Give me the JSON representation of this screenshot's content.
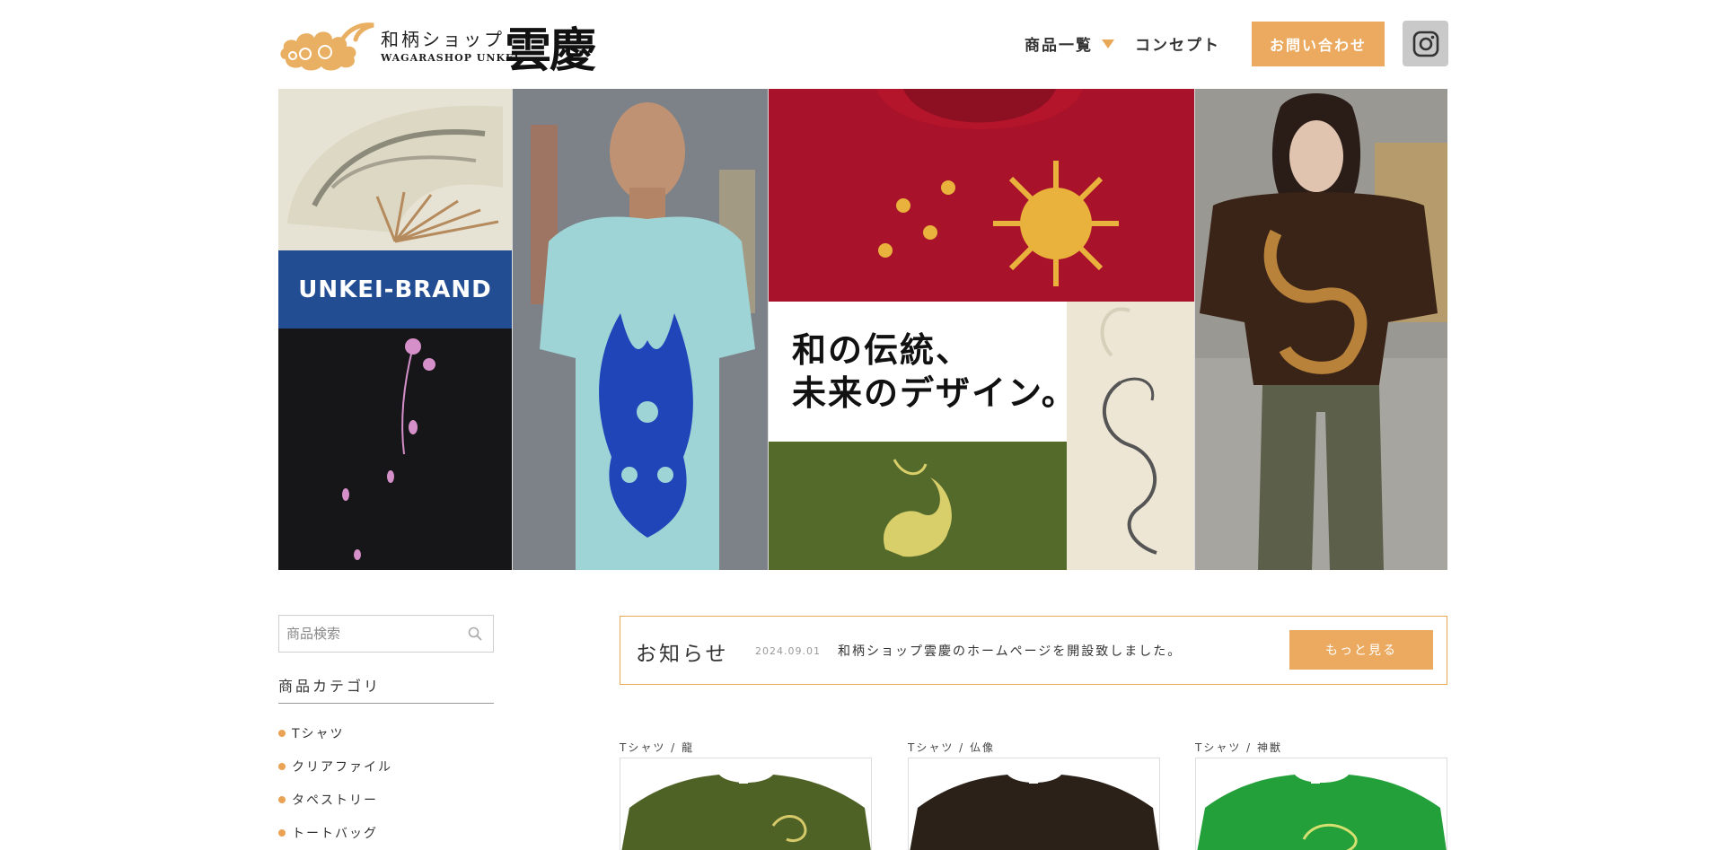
{
  "header": {
    "logo_jp": "和柄ショップ",
    "logo_en": "WAGARASHOP UNKEI",
    "logo_kanji": "雲慶",
    "nav": {
      "products_label": "商品一覧",
      "concept_label": "コンセプト",
      "contact_label": "お問い合わせ"
    }
  },
  "hero": {
    "brand_label": "UNKEI-BRAND",
    "headline_line1": "和の伝統、",
    "headline_line2": "未来のデザイン。"
  },
  "sidebar": {
    "search_placeholder": "商品検索",
    "category_heading": "商品カテゴリ",
    "categories": [
      "Tシャツ",
      "クリアファイル",
      "タペストリー",
      "トートバッグ"
    ]
  },
  "news": {
    "title": "お知らせ",
    "date": "2024.09.01",
    "text": "和柄ショップ雲慶のホームページを開設致しました。",
    "more_label": "もっと見る"
  },
  "products": [
    {
      "label": "Tシャツ / 龍",
      "shirt_color": "#4f6226"
    },
    {
      "label": "Tシャツ / 仏像",
      "shirt_color": "#2b2118"
    },
    {
      "label": "Tシャツ / 神獣",
      "shirt_color": "#23a03a"
    }
  ],
  "colors": {
    "accent": "#ebaa5f",
    "brand_blue": "#234d92",
    "instagram_bg": "#c9c9c9"
  }
}
